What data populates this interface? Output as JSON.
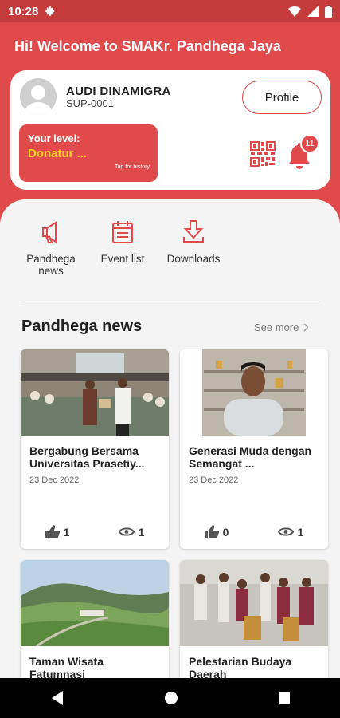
{
  "status_bar": {
    "time": "10:28"
  },
  "header": {
    "welcome": "Hi! Welcome to SMAKr. Pandhega Jaya"
  },
  "profile": {
    "name": "AUDI DINAMIGRA",
    "member_id": "SUP-0001",
    "profile_button": "Profile",
    "level_label": "Your level:",
    "level_value": "Donatur ...",
    "level_hint": "Tap for history",
    "notification_count": "11"
  },
  "menu": [
    {
      "label": "Pandhega news",
      "icon": "megaphone-icon"
    },
    {
      "label": "Event list",
      "icon": "calendar-icon"
    },
    {
      "label": "Downloads",
      "icon": "download-icon"
    }
  ],
  "news_section": {
    "title": "Pandhega news",
    "see_more": "See more"
  },
  "news": [
    {
      "title": "Bergabung Bersama Universitas Prasetiy...",
      "date": "23 Dec 2022",
      "likes": "1",
      "views": "1"
    },
    {
      "title": "Generasi Muda dengan Semangat ...",
      "date": "23 Dec 2022",
      "likes": "0",
      "views": "1"
    },
    {
      "title": "Taman Wisata Fatumnasi",
      "date": "",
      "likes": "",
      "views": ""
    },
    {
      "title": "Pelestarian Budaya Daerah",
      "date": "",
      "likes": "",
      "views": ""
    }
  ],
  "colors": {
    "primary": "#e04a4a",
    "level_text": "#f8d21c",
    "status_bar": "#c53a3a"
  }
}
